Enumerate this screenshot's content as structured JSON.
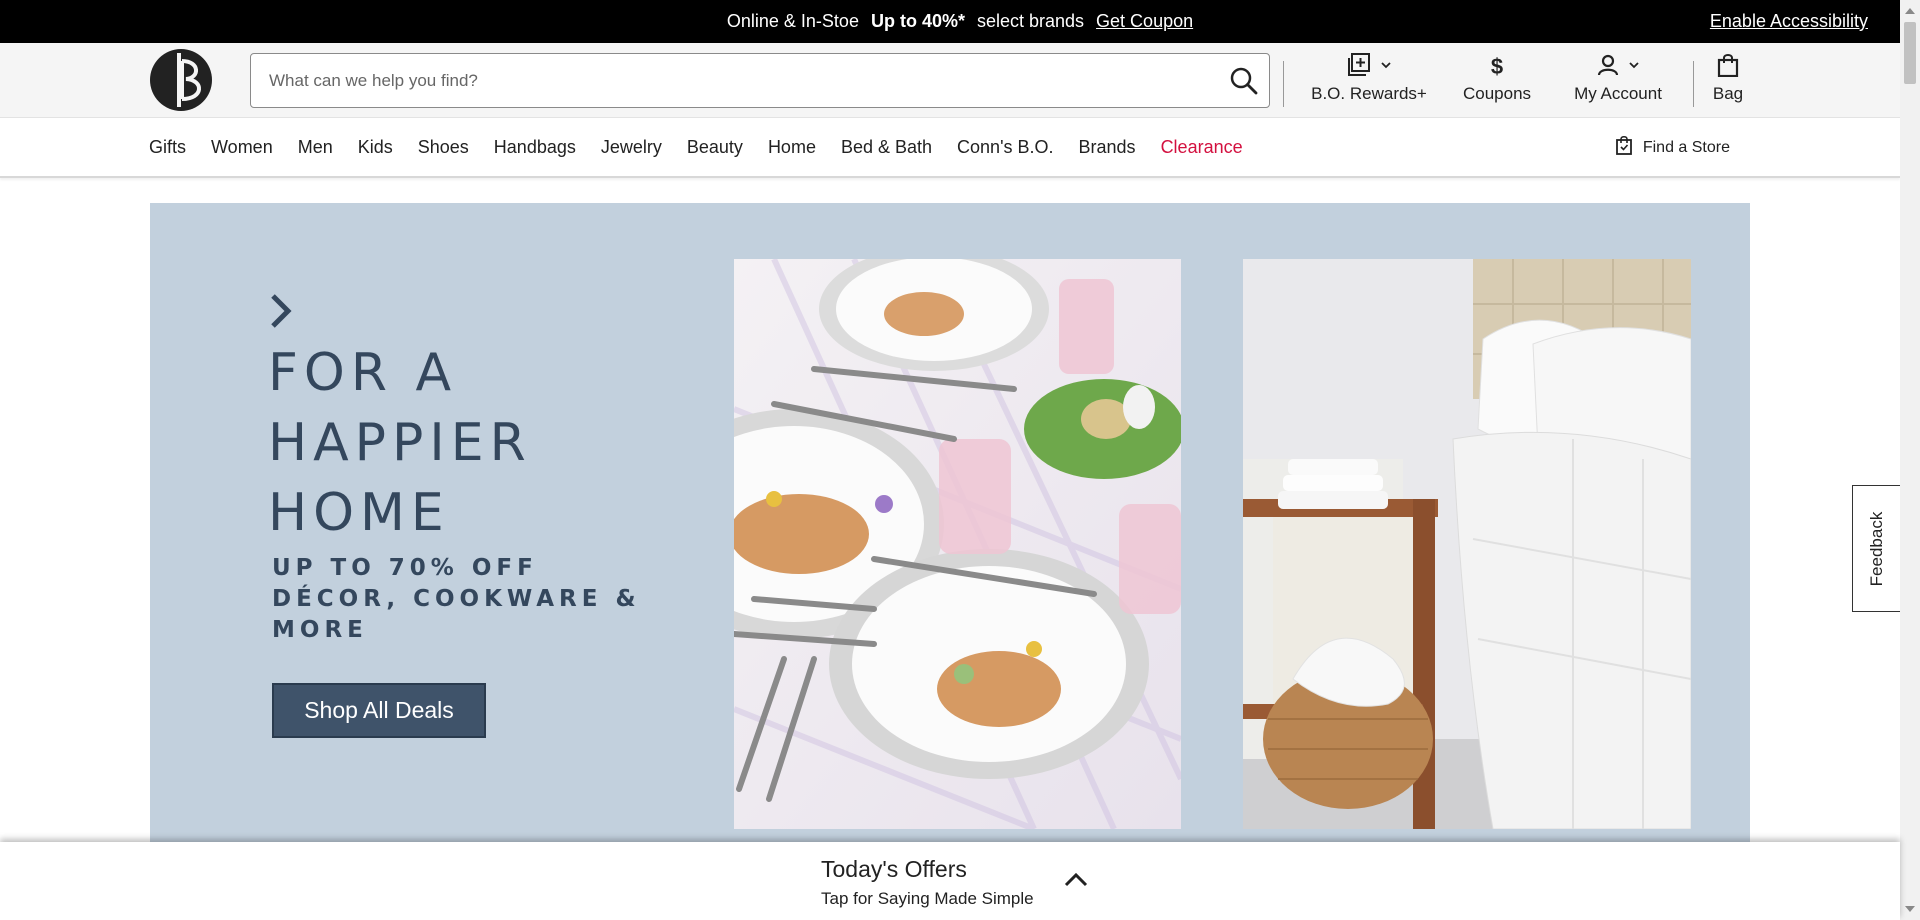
{
  "promo_bar": {
    "segment1": "Online & In-Stoe",
    "segment2": "Up to 40%*",
    "segment3": "select brands",
    "coupon_link": "Get Coupon",
    "accessibility_link": "Enable Accessibility"
  },
  "header": {
    "logo_icon": "brand-logo-icon",
    "search": {
      "placeholder": "What can we help you find?",
      "value": ""
    },
    "rewards_label": "B.O. Rewards+",
    "coupons_label": "Coupons",
    "account_label": "My Account",
    "bag_label": "Bag"
  },
  "nav": {
    "items": [
      "Gifts",
      "Women",
      "Men",
      "Kids",
      "Shoes",
      "Handbags",
      "Jewelry",
      "Beauty",
      "Home",
      "Bed & Bath",
      "Conn's B.O.",
      "Brands",
      "Clearance"
    ],
    "find_store": "Find a Store"
  },
  "hero": {
    "headline": "FOR A HAPPIER HOME",
    "subhead": "UP TO 70% OFF DÉCOR, COOKWARE & MORE",
    "cta": "Shop All Deals"
  },
  "feedback_label": "Feedback",
  "offers": {
    "title": "Today's Offers",
    "subtitle": "Tap for Saying Made Simple"
  },
  "colors": {
    "promo_bg": "#000000",
    "hero_bg": "#c2d0dd",
    "hero_text": "#34475d",
    "cta_bg": "#3f536a",
    "clearance": "#d3103f"
  }
}
